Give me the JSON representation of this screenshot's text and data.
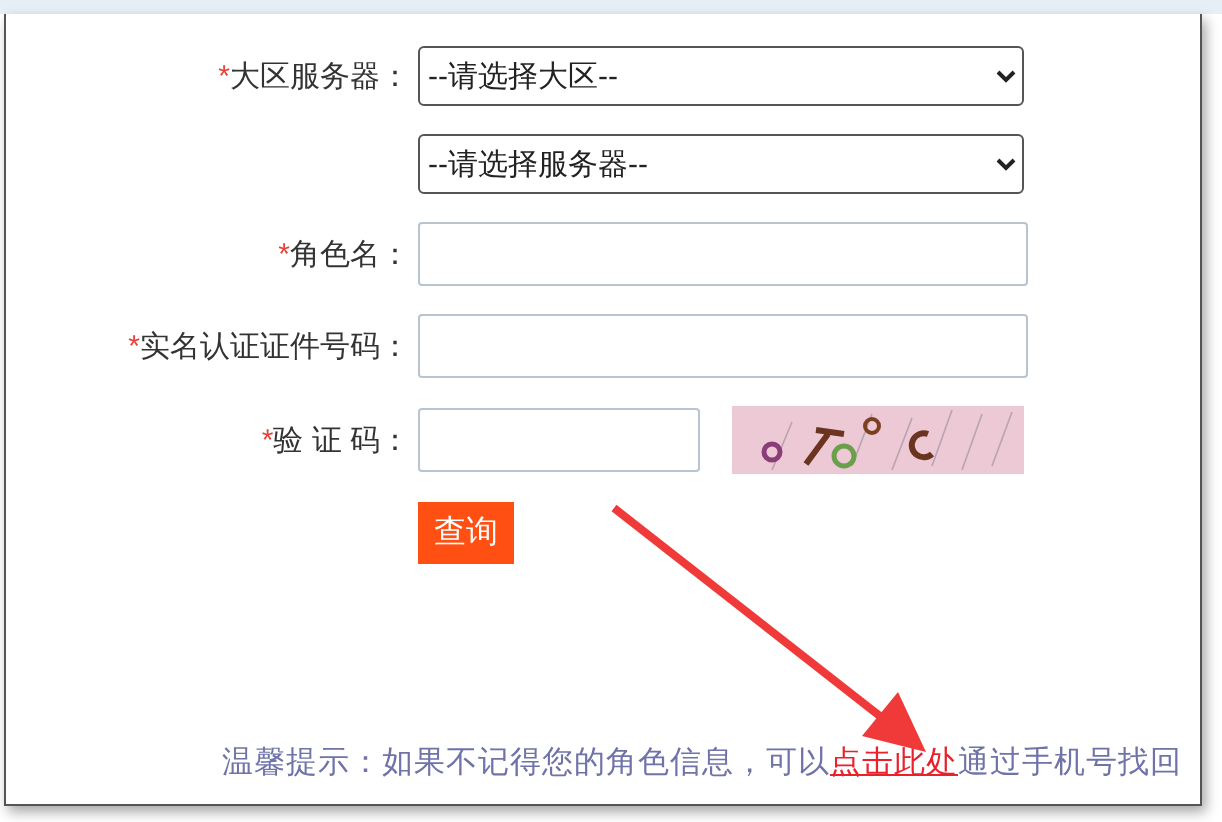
{
  "form": {
    "fields": [
      {
        "kind": "select",
        "label": "大区服务器：",
        "required_mark": "*",
        "value": "--请选择大区--"
      },
      {
        "kind": "select",
        "value": "--请选择服务器--"
      },
      {
        "kind": "input",
        "label": "角色名：",
        "required_mark": "*"
      },
      {
        "kind": "input",
        "label": "实名认证证件号码：",
        "required_mark": "*"
      },
      {
        "kind": "captcha",
        "label": "验 证 码：",
        "required_mark": "*"
      }
    ],
    "submit_button": "查询"
  },
  "hint": {
    "text_before": "温馨提示：如果不记得您的角色信息，可以",
    "link": "点击此处",
    "text_after": "通过手机号找回"
  }
}
